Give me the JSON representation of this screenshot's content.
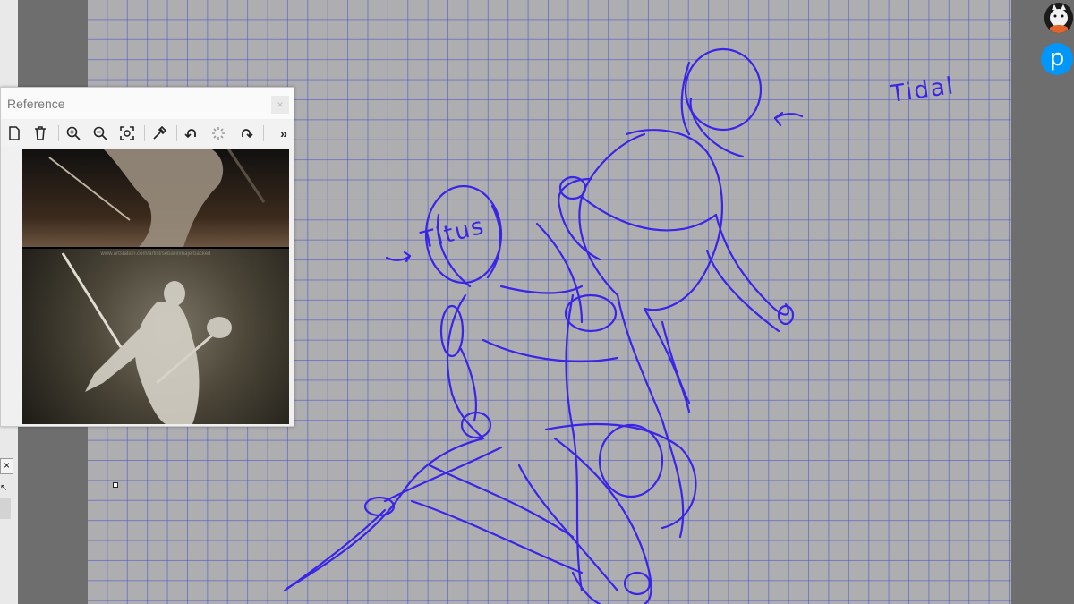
{
  "reference_panel": {
    "title": "Reference",
    "close_symbol": "×",
    "toolbar": {
      "icons": [
        "new-file-icon",
        "delete-icon",
        "zoom-in-icon",
        "zoom-out-icon",
        "fit-view-icon",
        "eyedropper-icon",
        "rotate-left-icon",
        "loading-icon",
        "rotate-right-icon"
      ],
      "more_symbol": "»"
    },
    "image_caption": "www.artstation.com/artist/seballinmajerbacked"
  },
  "canvas": {
    "grid_color": "#5060c8",
    "sketch_color": "#3a24e8",
    "labels": {
      "tidal": "Tidal",
      "titus": "Titus"
    }
  },
  "left_strip": {
    "close_symbol": "×",
    "tool_symbol": "↖"
  },
  "badges": {
    "pixiv_letter": "p"
  }
}
